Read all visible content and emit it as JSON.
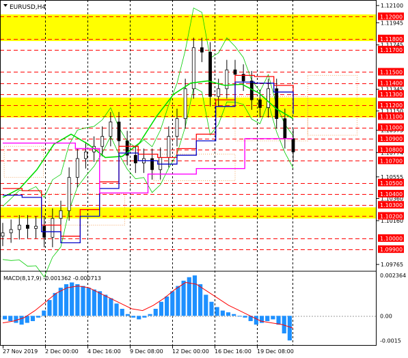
{
  "window": {
    "symbol_label": "EURUSD,H4",
    "menu_arrow": "dropdown-triangle-icon"
  },
  "macd": {
    "label": "MACD(8,17,9) -0.001362 -0.000713",
    "axis_labels": [
      "0.002364",
      "0.00",
      "-0.0015"
    ]
  },
  "price_axis": {
    "plain_labels": [
      "1.12100",
      "1.11945",
      "1.11745",
      "1.11345",
      "1.11150",
      "1.10975",
      "1.10774",
      "1.10555",
      "1.10360",
      "1.10160",
      "1.09765"
    ],
    "highlighted_labels": [
      "1.12000",
      "1.11800",
      "1.11700",
      "1.11500",
      "1.11400",
      "1.11300",
      "1.11200",
      "1.11100",
      "1.11000",
      "1.10900",
      "1.10800",
      "1.10700",
      "1.10500",
      "1.10400",
      "1.10300",
      "1.10200",
      "1.10000",
      "1.09900"
    ]
  },
  "time_axis": [
    "27 Nov 2019",
    "2 Dec 00:00",
    "4 Dec 16:00",
    "9 Dec 08:00",
    "12 Dec 00:00",
    "16 Dec 16:00",
    "19 Dec 08:00"
  ],
  "colors": {
    "support_resistance": "#ff0000",
    "zone_fill": "#ffff00",
    "label_bg": "#ff0000",
    "macd_hist": "#1e90ff",
    "macd_signal": "#ff0000",
    "tenkan": "#ff0000",
    "kijun": "#0000c8",
    "chikou": "#00dd00",
    "span_b_line": "#ff00ff",
    "cloud": "#f4a460",
    "bollinger": "#00cc00",
    "candles": "#000000"
  },
  "chart_data": [
    {
      "type": "line",
      "title": "EURUSD,H4",
      "ylim": [
        1.0971,
        1.1215
      ],
      "x": [
        "27 Nov 2019",
        "2 Dec 00:00",
        "4 Dec 16:00",
        "9 Dec 08:00",
        "12 Dec 00:00",
        "16 Dec 16:00",
        "19 Dec 08:00"
      ],
      "horizontal_levels": [
        1.12,
        1.118,
        1.117,
        1.115,
        1.114,
        1.113,
        1.112,
        1.111,
        1.11,
        1.109,
        1.108,
        1.107,
        1.105,
        1.104,
        1.103,
        1.102,
        1.1,
        1.099
      ],
      "highlight_zones": [
        [
          1.1178,
          1.1202
        ],
        [
          1.1109,
          1.1127
        ],
        [
          1.1018,
          1.1028
        ]
      ],
      "series": [
        {
          "values": [
            1.1005,
            1.1008,
            1.1012,
            1.1009,
            1.1011,
            1.1001,
            1.1018,
            1.1025,
            1.1055,
            1.1072,
            1.1078,
            1.1083,
            1.1092,
            1.1105,
            1.1088,
            1.1075,
            1.1068,
            1.1072,
            1.1062,
            1.1073,
            1.1092,
            1.1108,
            1.1135,
            1.1172,
            1.1168,
            1.1128,
            1.1135,
            1.1152,
            1.1148,
            1.1142,
            1.1125,
            1.1118,
            1.1135,
            1.1108,
            1.109,
            1.1078
          ]
        },
        {
          "values": [
            1.1037,
            1.1045,
            1.1062,
            1.1085,
            1.1094,
            1.1085,
            1.1073,
            1.1074,
            1.1086,
            1.111,
            1.113,
            1.114,
            1.1142,
            1.1138,
            1.1139,
            1.1131,
            1.1117,
            1.1108
          ]
        },
        {
          "values": [
            1.1045,
            1.1043,
            1.1012,
            1.1002,
            1.1026,
            1.1051,
            1.1083,
            1.1076,
            1.1073,
            1.1081,
            1.1094,
            1.1125,
            1.1147,
            1.1146,
            1.1138,
            1.1118
          ]
        },
        {
          "values": [
            1.1086,
            1.1086,
            1.1086,
            1.1081,
            1.1041,
            1.1041,
            1.1058,
            1.1058,
            1.1063,
            1.1063,
            1.109,
            1.109,
            1.109
          ]
        }
      ]
    },
    {
      "type": "bar",
      "title": "MACD(8,17,9) -0.001362 -0.000713",
      "ylim": [
        -0.0017,
        0.0025
      ],
      "x": [
        "27 Nov 2019",
        "2 Dec 00:00",
        "4 Dec 16:00",
        "9 Dec 08:00",
        "12 Dec 00:00",
        "16 Dec 16:00",
        "19 Dec 08:00"
      ],
      "series": [
        {
          "values": [
            -0.0002,
            -0.0003,
            -0.0004,
            -0.0005,
            -0.0004,
            -0.0003,
            -0.0001,
            0.0003,
            0.0009,
            0.0013,
            0.0016,
            0.0018,
            0.0019,
            0.0018,
            0.0017,
            0.0016,
            0.0015,
            0.0014,
            0.0012,
            0.001,
            0.0007,
            0.0004,
            0.0001,
            -0.0001,
            -0.0002,
            -0.0001,
            0.0001,
            0.0004,
            0.0008,
            0.0011,
            0.0014,
            0.0017,
            0.002,
            0.0022,
            0.0023,
            0.0018,
            0.0012,
            0.0008,
            0.0005,
            0.0003,
            0.0002,
            0.0001,
            0.0,
            -0.0001,
            -0.0003,
            -0.0005,
            -0.0004,
            -0.0003,
            -0.0002,
            -0.0005,
            -0.001,
            -0.0014
          ]
        },
        {
          "values": [
            -0.0004,
            -0.0003,
            -0.0001,
            0.0003,
            0.0008,
            0.0013,
            0.0016,
            0.0017,
            0.0016,
            0.0013,
            0.001,
            0.0007,
            0.0004,
            0.0003,
            0.0006,
            0.001,
            0.0015,
            0.0019,
            0.0018,
            0.0014,
            0.001,
            0.0006,
            0.0003,
            0.0,
            -0.0003,
            -0.0004,
            -0.0005,
            -0.0007
          ]
        }
      ]
    }
  ]
}
